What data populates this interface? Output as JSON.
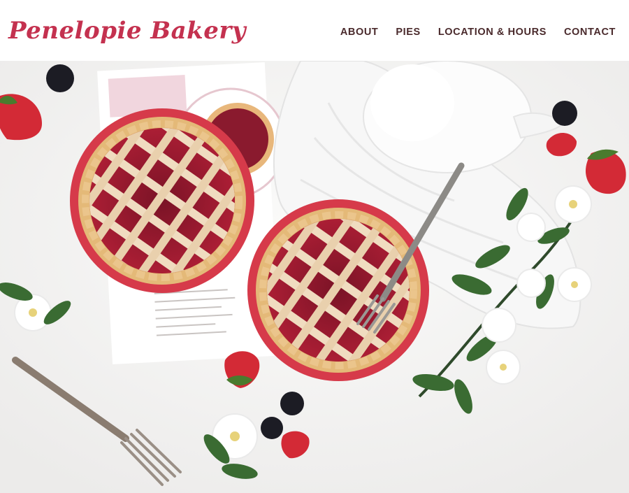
{
  "site": {
    "logo_text": "Penelopie Bakery",
    "brand_color": "#c4314f",
    "nav_color": "#4a2a2c"
  },
  "nav": {
    "items": [
      {
        "label": "ABOUT"
      },
      {
        "label": "PIES"
      },
      {
        "label": "LOCATION & HOURS"
      },
      {
        "label": "CONTACT"
      }
    ]
  },
  "hero": {
    "description": "",
    "icons": [
      "pie-icon",
      "fork-icon",
      "teapot-icon",
      "strawberry-icon",
      "blackberry-icon",
      "flower-icon"
    ]
  }
}
